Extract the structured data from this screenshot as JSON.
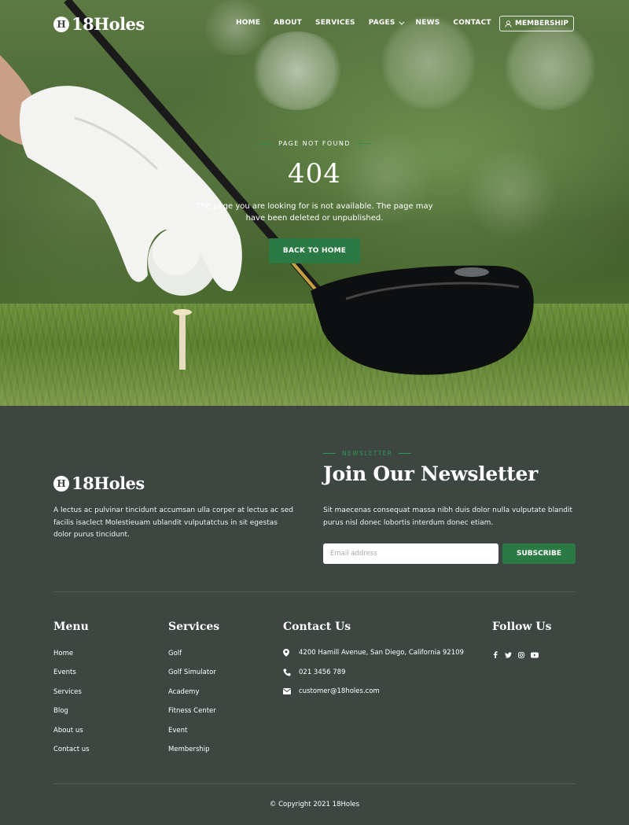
{
  "brand": {
    "badge": "H",
    "name": "18Holes"
  },
  "nav": {
    "items": [
      {
        "label": "HOME"
      },
      {
        "label": "ABOUT"
      },
      {
        "label": "SERVICES"
      },
      {
        "label": "PAGES",
        "has_dropdown": true
      },
      {
        "label": "NEWS"
      },
      {
        "label": "CONTACT"
      }
    ],
    "membership_label": "MEMBERSHIP",
    "membership_icon": "user-icon"
  },
  "hero": {
    "eyebrow": "PAGE NOT FOUND",
    "code": "404",
    "description": "The page you are looking for is not available. The page may have been deleted or unpublished.",
    "button_label": "BACK TO HOME"
  },
  "footer": {
    "about_text": "A lectus ac pulvinar tincidunt accumsan ulla corper at lectus ac sed facilis isaclect Molestieuam ublandit vulputatctus in sit egestas dolor purus tincidunt.",
    "newsletter": {
      "eyebrow": "NEWSLETTER",
      "title": "Join Our Newsletter",
      "text": "Sit maecenas consequat massa nibh duis dolor nulla vulputate blandit purus nisl donec lobortis interdum donec etiam.",
      "placeholder": "Email address",
      "button_label": "SUBSCRIBE"
    },
    "menu": {
      "title": "Menu",
      "items": [
        "Home",
        "Events",
        "Services",
        "Blog",
        "About us",
        "Contact us"
      ]
    },
    "services": {
      "title": "Services",
      "items": [
        "Golf",
        "Golf Simulator",
        "Academy",
        "Fitness Center",
        "Event",
        "Membership"
      ]
    },
    "contact": {
      "title": "Contact Us",
      "address": "4200 Hamill Avenue, San Diego, California 92109",
      "phone": "021 3456 789",
      "email": "customer@18holes.com",
      "icons": [
        "map-marker-icon",
        "phone-icon",
        "envelope-icon"
      ]
    },
    "follow": {
      "title": "Follow Us",
      "icons": [
        "facebook-icon",
        "twitter-icon",
        "instagram-icon",
        "youtube-icon"
      ]
    },
    "copyright": "© Copyright 2021 18Holes"
  },
  "colors": {
    "accent": "#2b7a45",
    "footer_bg": "#3d4641"
  }
}
